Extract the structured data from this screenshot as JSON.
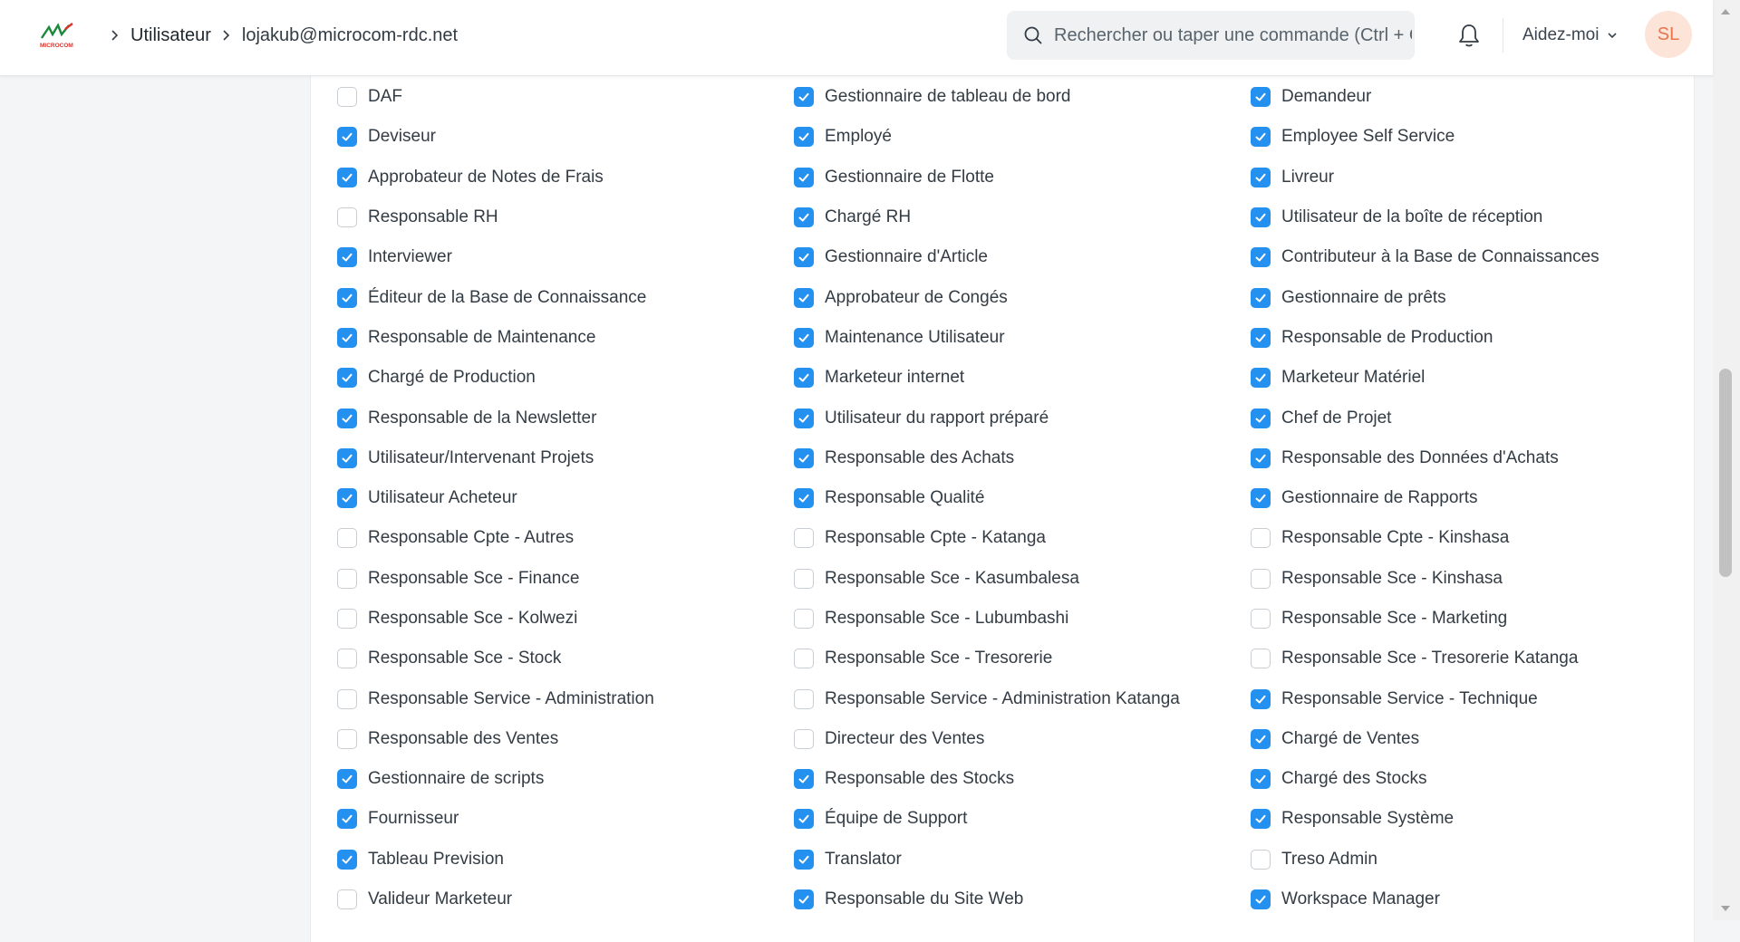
{
  "header": {
    "logo_text": "MICROCOM",
    "breadcrumb": {
      "parent": "Utilisateur",
      "current": "lojakub@microcom-rdc.net"
    },
    "search_placeholder": "Rechercher ou taper une commande (Ctrl + G)",
    "help_label": "Aidez-moi",
    "avatar_initials": "SL"
  },
  "colors": {
    "accent": "#2490ef",
    "avatar_bg": "#fde4d8",
    "avatar_fg": "#e8754b"
  },
  "roles": [
    {
      "label": "DAF",
      "checked": false
    },
    {
      "label": "Gestionnaire de tableau de bord",
      "checked": true
    },
    {
      "label": "Demandeur",
      "checked": true
    },
    {
      "label": "Deviseur",
      "checked": true
    },
    {
      "label": "Employé",
      "checked": true
    },
    {
      "label": "Employee Self Service",
      "checked": true
    },
    {
      "label": "Approbateur de Notes de Frais",
      "checked": true
    },
    {
      "label": "Gestionnaire de Flotte",
      "checked": true
    },
    {
      "label": "Livreur",
      "checked": true
    },
    {
      "label": "Responsable RH",
      "checked": false
    },
    {
      "label": "Chargé RH",
      "checked": true
    },
    {
      "label": "Utilisateur de la boîte de réception",
      "checked": true
    },
    {
      "label": "Interviewer",
      "checked": true
    },
    {
      "label": "Gestionnaire d'Article",
      "checked": true
    },
    {
      "label": "Contributeur à la Base de Connaissances",
      "checked": true
    },
    {
      "label": "Éditeur de la Base de Connaissance",
      "checked": true
    },
    {
      "label": "Approbateur de Congés",
      "checked": true
    },
    {
      "label": "Gestionnaire de prêts",
      "checked": true
    },
    {
      "label": "Responsable de Maintenance",
      "checked": true
    },
    {
      "label": "Maintenance Utilisateur",
      "checked": true
    },
    {
      "label": "Responsable de Production",
      "checked": true
    },
    {
      "label": "Chargé de Production",
      "checked": true
    },
    {
      "label": "Marketeur internet",
      "checked": true
    },
    {
      "label": "Marketeur Matériel",
      "checked": true
    },
    {
      "label": "Responsable de la Newsletter",
      "checked": true
    },
    {
      "label": "Utilisateur du rapport préparé",
      "checked": true
    },
    {
      "label": "Chef de Projet",
      "checked": true
    },
    {
      "label": "Utilisateur/Intervenant Projets",
      "checked": true
    },
    {
      "label": "Responsable des Achats",
      "checked": true
    },
    {
      "label": "Responsable des Données d'Achats",
      "checked": true
    },
    {
      "label": "Utilisateur Acheteur",
      "checked": true
    },
    {
      "label": "Responsable Qualité",
      "checked": true
    },
    {
      "label": "Gestionnaire de Rapports",
      "checked": true
    },
    {
      "label": "Responsable Cpte - Autres",
      "checked": false
    },
    {
      "label": "Responsable Cpte - Katanga",
      "checked": false
    },
    {
      "label": "Responsable Cpte - Kinshasa",
      "checked": false
    },
    {
      "label": "Responsable Sce - Finance",
      "checked": false
    },
    {
      "label": "Responsable Sce - Kasumbalesa",
      "checked": false
    },
    {
      "label": "Responsable Sce - Kinshasa",
      "checked": false
    },
    {
      "label": "Responsable Sce - Kolwezi",
      "checked": false
    },
    {
      "label": "Responsable Sce - Lubumbashi",
      "checked": false
    },
    {
      "label": "Responsable Sce - Marketing",
      "checked": false
    },
    {
      "label": "Responsable Sce - Stock",
      "checked": false
    },
    {
      "label": "Responsable Sce - Tresorerie",
      "checked": false
    },
    {
      "label": "Responsable Sce - Tresorerie Katanga",
      "checked": false
    },
    {
      "label": "Responsable Service - Administration",
      "checked": false
    },
    {
      "label": "Responsable Service - Administration Katanga",
      "checked": false
    },
    {
      "label": "Responsable Service - Technique",
      "checked": true
    },
    {
      "label": "Responsable des Ventes",
      "checked": false
    },
    {
      "label": "Directeur des Ventes",
      "checked": false
    },
    {
      "label": "Chargé de Ventes",
      "checked": true
    },
    {
      "label": "Gestionnaire de scripts",
      "checked": true
    },
    {
      "label": "Responsable des Stocks",
      "checked": true
    },
    {
      "label": "Chargé des Stocks",
      "checked": true
    },
    {
      "label": "Fournisseur",
      "checked": true
    },
    {
      "label": "Équipe de Support",
      "checked": true
    },
    {
      "label": "Responsable Système",
      "checked": true
    },
    {
      "label": "Tableau Prevision",
      "checked": true
    },
    {
      "label": "Translator",
      "checked": true
    },
    {
      "label": "Treso Admin",
      "checked": false
    },
    {
      "label": "Valideur Marketeur",
      "checked": false
    },
    {
      "label": "Responsable du Site Web",
      "checked": true
    },
    {
      "label": "Workspace Manager",
      "checked": true
    }
  ]
}
